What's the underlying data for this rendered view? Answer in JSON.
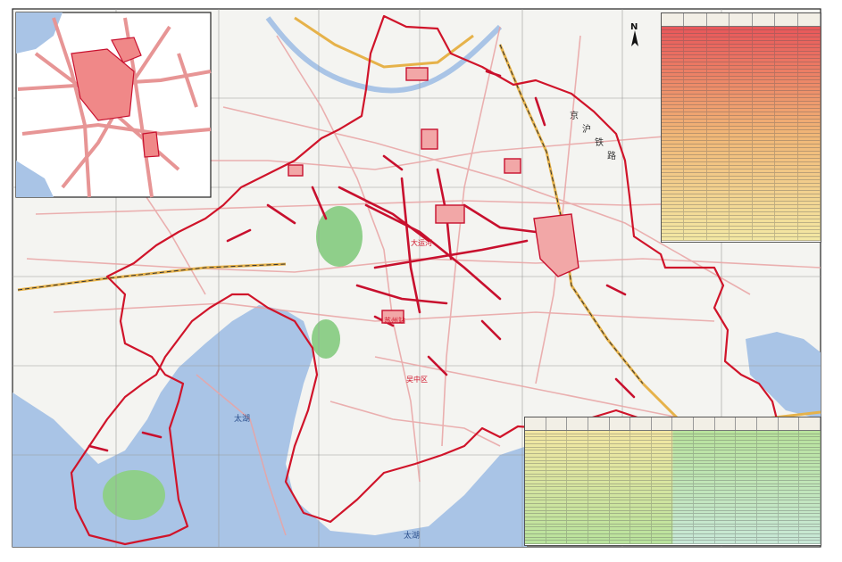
{
  "map": {
    "north_label": "N",
    "lake_label_main": "太湖",
    "lake_label_south": "太湖",
    "railway_label_chars": [
      "京",
      "沪",
      "铁",
      "路"
    ],
    "district_labels": [
      "大运河",
      "苏州站",
      "吴中区"
    ]
  },
  "colors": {
    "water": "#a9c4e6",
    "park": "#8fcf8a",
    "road": "#e9a4a4",
    "highway": "#e6b24a",
    "boundary": "#d0142a",
    "street_highlight": "#c8102e",
    "table_top": "#e8585a",
    "table_mid": "#f1b676",
    "table_low": "#f3e7a3",
    "table_green": "#b9e39d"
  },
  "tables": {
    "top_right_rows": 60,
    "bottom_right_rows": 34
  }
}
